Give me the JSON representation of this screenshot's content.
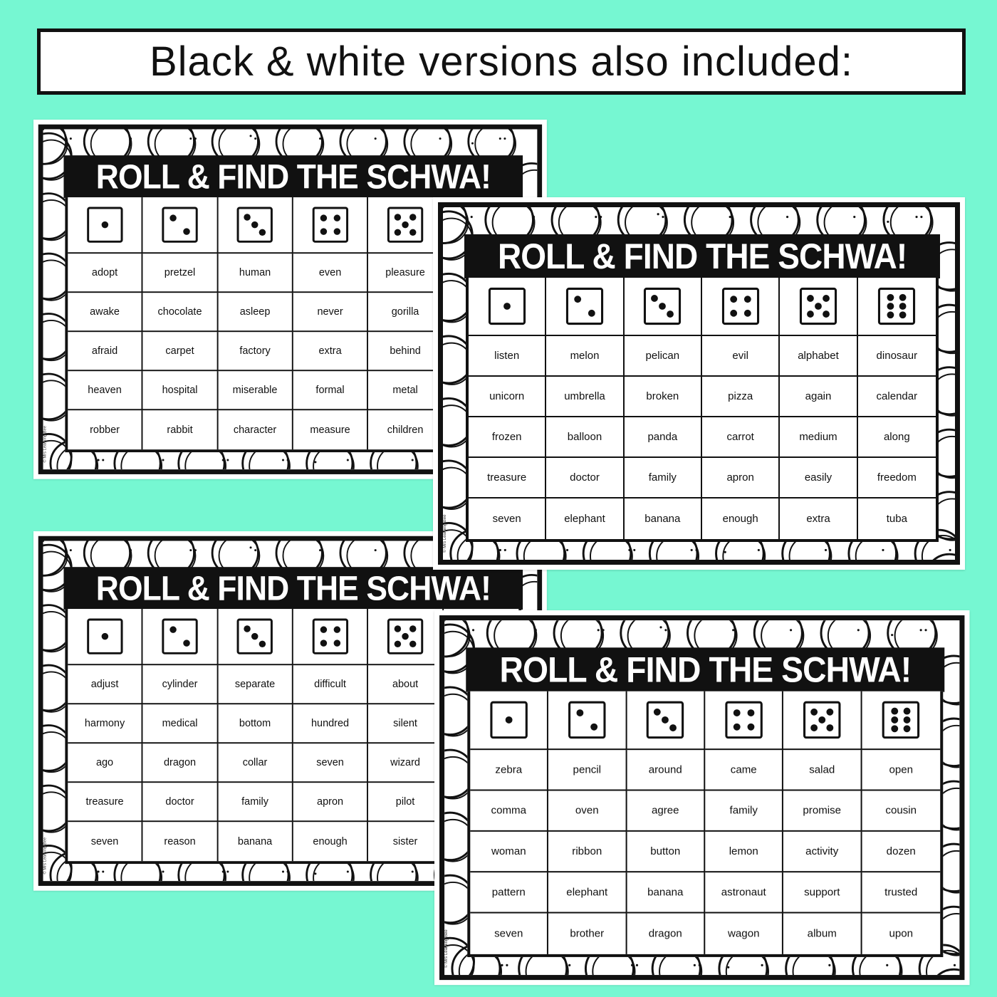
{
  "banner": {
    "text": "Black & white versions also included:"
  },
  "colors": {
    "background": "#76f7d2",
    "ink": "#111111",
    "paper": "#ffffff"
  },
  "copyright": "© Mrs Learning Bee",
  "cards": [
    {
      "title": "ROLL & FIND THE SCHWA!",
      "dice": [
        1,
        2,
        3,
        4,
        5
      ],
      "rows": [
        [
          "adopt",
          "pretzel",
          "human",
          "even",
          "pleasure"
        ],
        [
          "awake",
          "chocolate",
          "asleep",
          "never",
          "gorilla"
        ],
        [
          "afraid",
          "carpet",
          "factory",
          "extra",
          "behind"
        ],
        [
          "heaven",
          "hospital",
          "miserable",
          "formal",
          "metal"
        ],
        [
          "robber",
          "rabbit",
          "character",
          "measure",
          "children"
        ]
      ]
    },
    {
      "title": "ROLL & FIND THE SCHWA!",
      "dice": [
        1,
        2,
        3,
        4,
        5
      ],
      "rows": [
        [
          "adjust",
          "cylinder",
          "separate",
          "difficult",
          "about"
        ],
        [
          "harmony",
          "medical",
          "bottom",
          "hundred",
          "silent"
        ],
        [
          "ago",
          "dragon",
          "collar",
          "seven",
          "wizard"
        ],
        [
          "treasure",
          "doctor",
          "family",
          "apron",
          "pilot"
        ],
        [
          "seven",
          "reason",
          "banana",
          "enough",
          "sister"
        ]
      ]
    },
    {
      "title": "ROLL & FIND THE SCHWA!",
      "dice": [
        1,
        2,
        3,
        4,
        5,
        6
      ],
      "rows": [
        [
          "listen",
          "melon",
          "pelican",
          "evil",
          "alphabet",
          "dinosaur"
        ],
        [
          "unicorn",
          "umbrella",
          "broken",
          "pizza",
          "again",
          "calendar"
        ],
        [
          "frozen",
          "balloon",
          "panda",
          "carrot",
          "medium",
          "along"
        ],
        [
          "treasure",
          "doctor",
          "family",
          "apron",
          "easily",
          "freedom"
        ],
        [
          "seven",
          "elephant",
          "banana",
          "enough",
          "extra",
          "tuba"
        ]
      ]
    },
    {
      "title": "ROLL & FIND THE SCHWA!",
      "dice": [
        1,
        2,
        3,
        4,
        5,
        6
      ],
      "rows": [
        [
          "zebra",
          "pencil",
          "around",
          "came",
          "salad",
          "open"
        ],
        [
          "comma",
          "oven",
          "agree",
          "family",
          "promise",
          "cousin"
        ],
        [
          "woman",
          "ribbon",
          "button",
          "lemon",
          "activity",
          "dozen"
        ],
        [
          "pattern",
          "elephant",
          "banana",
          "astronaut",
          "support",
          "trusted"
        ],
        [
          "seven",
          "brother",
          "dragon",
          "wagon",
          "album",
          "upon"
        ]
      ]
    }
  ]
}
